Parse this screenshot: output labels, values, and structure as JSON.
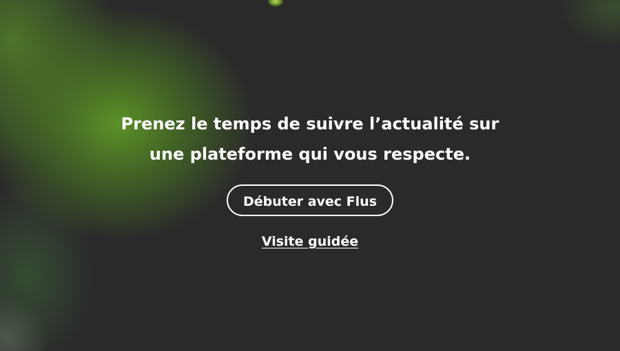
{
  "hero": {
    "headline_line1": "Prenez le temps de suivre l’actualité sur",
    "headline_line2": "une plateforme qui vous respecte.",
    "cta_label": "Débuter avec Flus",
    "tour_link": "Visite guidée"
  },
  "colors": {
    "background": "#2a2a2a",
    "accent": "#5f9628",
    "text": "#ffffff"
  }
}
